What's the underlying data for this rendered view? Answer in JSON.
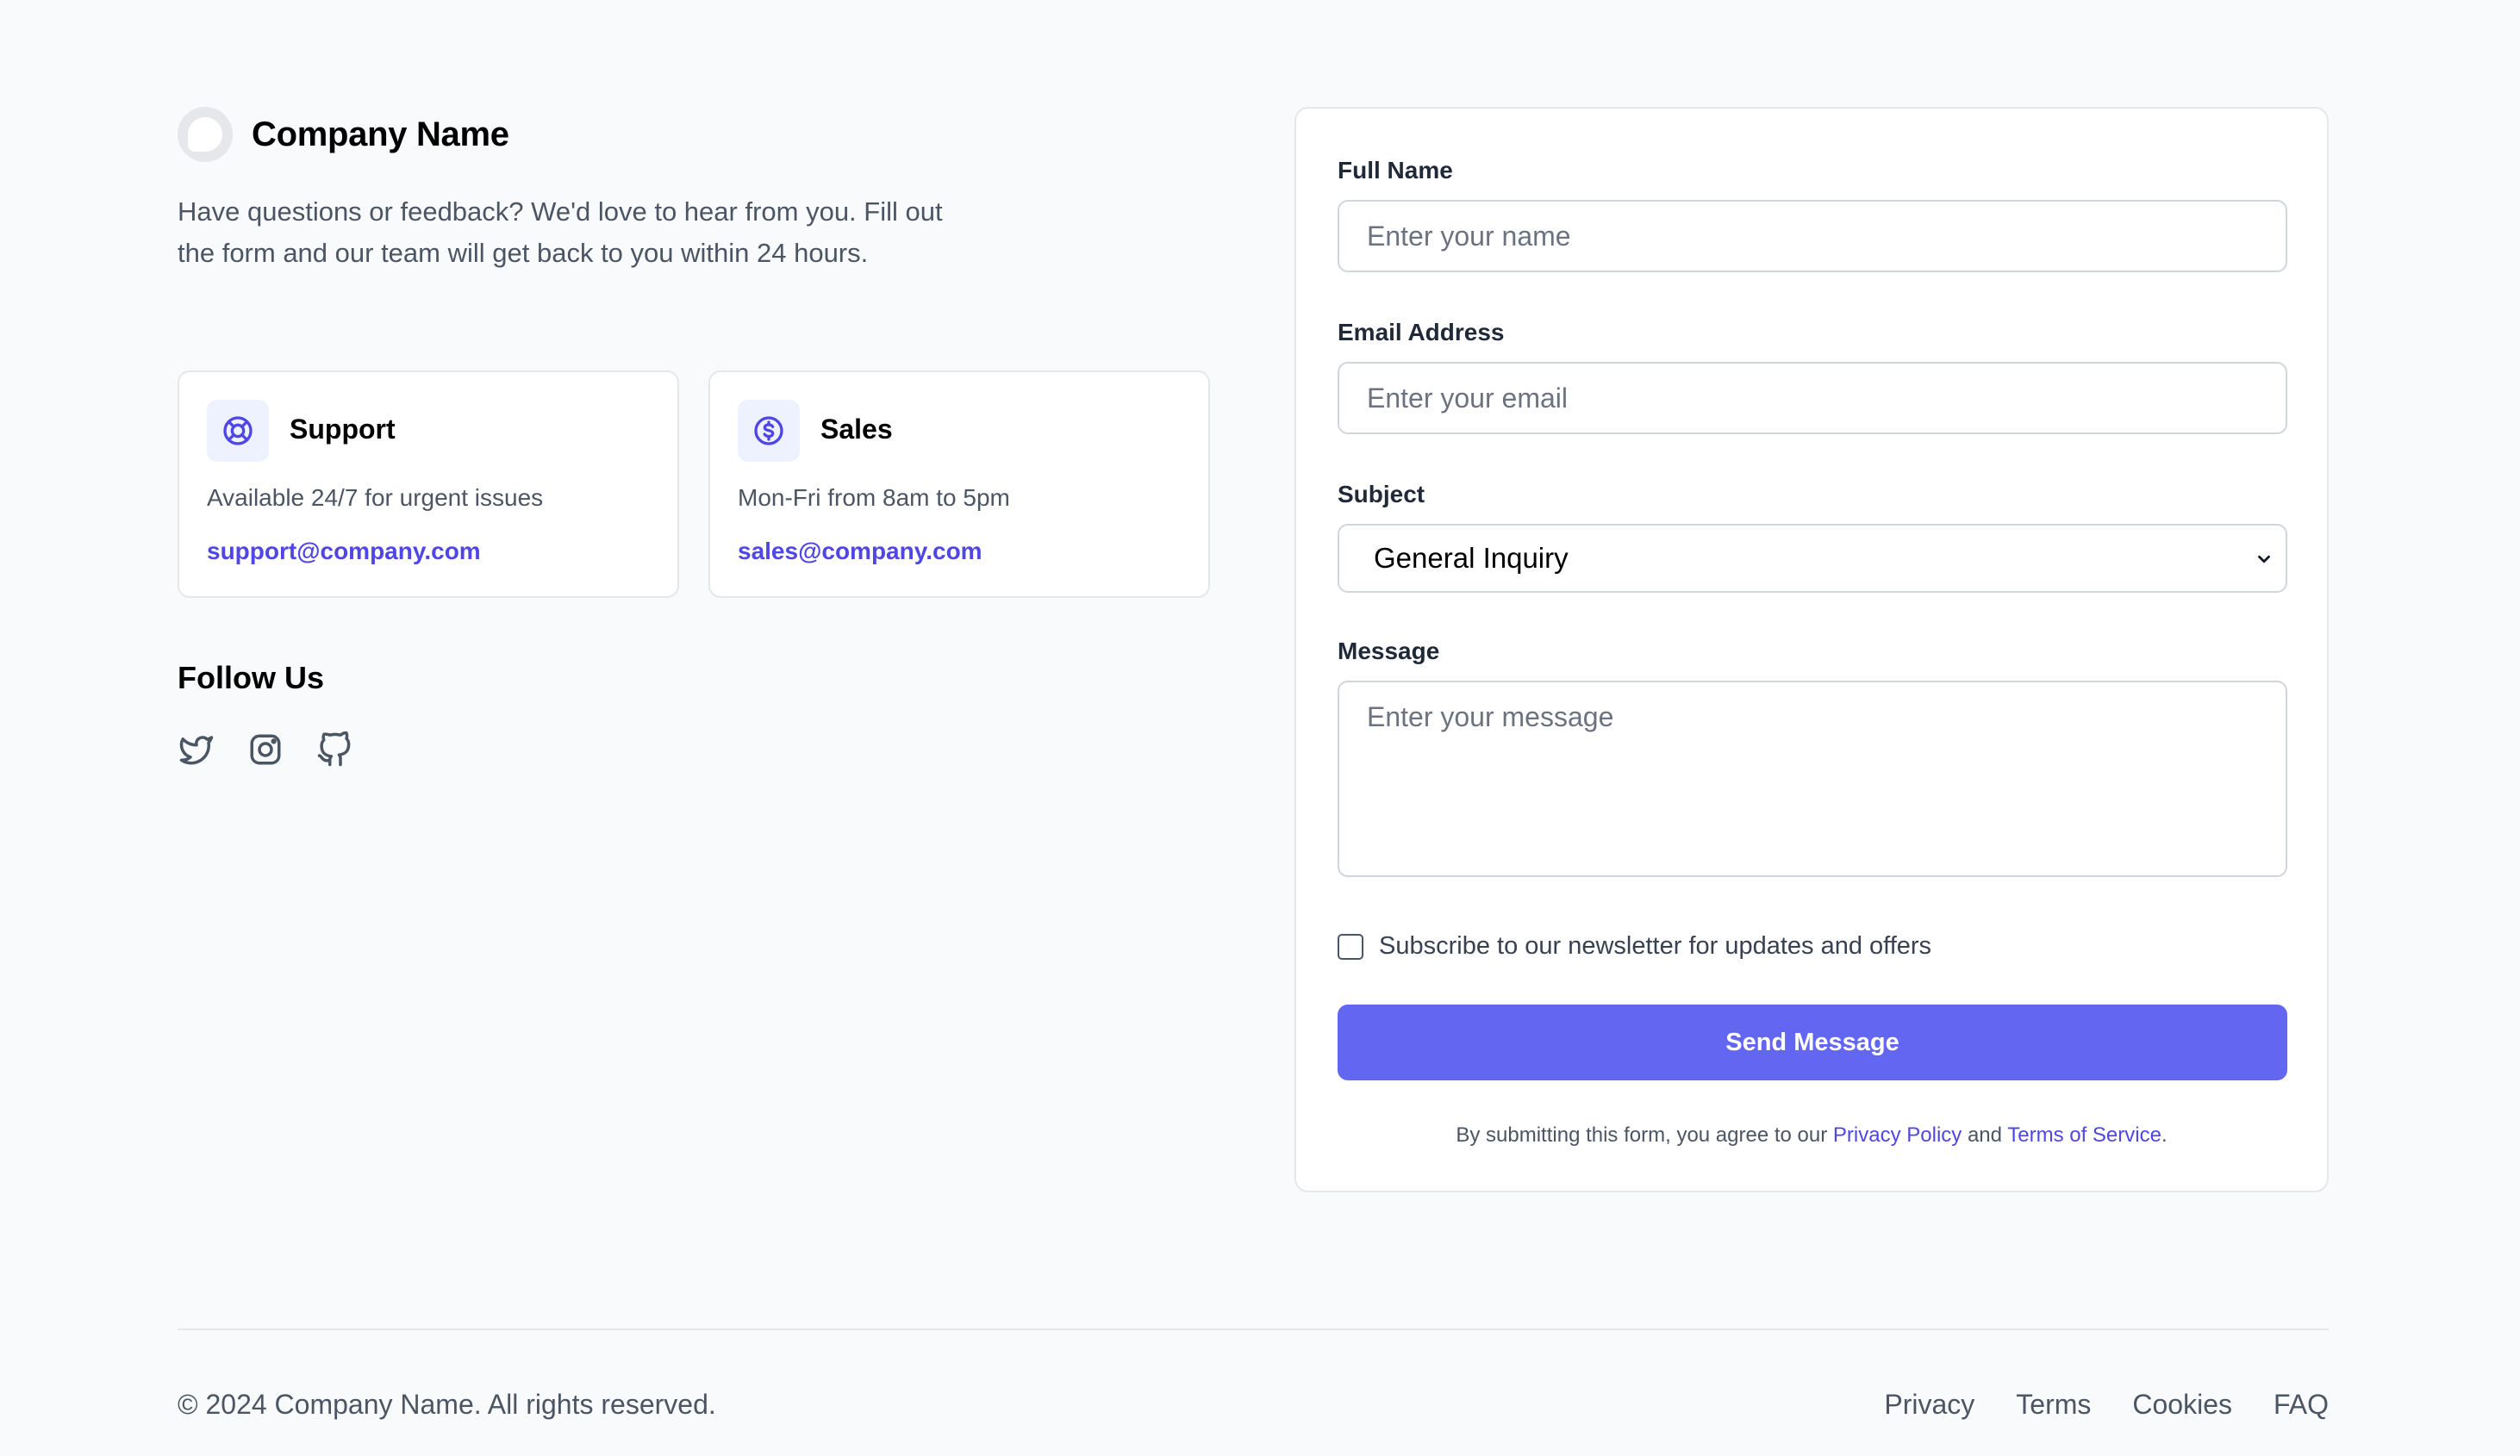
{
  "brand": {
    "name": "Company Name",
    "logo_icon": "company-logo"
  },
  "intro": "Have questions or feedback? We'd love to hear from you. Fill out the form and our team will get back to you within 24 hours.",
  "cards": {
    "support": {
      "icon": "lifebuoy-icon",
      "title": "Support",
      "description": "Available 24/7 for urgent issues",
      "email": "support@company.com"
    },
    "sales": {
      "icon": "dollar-circle-icon",
      "title": "Sales",
      "description": "Mon-Fri from 8am to 5pm",
      "email": "sales@company.com"
    }
  },
  "follow": {
    "title": "Follow Us",
    "icons": [
      "twitter-icon",
      "instagram-icon",
      "github-icon"
    ]
  },
  "form": {
    "name_label": "Full Name",
    "name_placeholder": "Enter your name",
    "email_label": "Email Address",
    "email_placeholder": "Enter your email",
    "subject_label": "Subject",
    "subject_value": "General Inquiry",
    "message_label": "Message",
    "message_placeholder": "Enter your message",
    "newsletter_label": "Subscribe to our newsletter for updates and offers",
    "newsletter_checked": false,
    "submit_label": "Send Message",
    "legal_prefix": "By submitting this form, you agree to our",
    "privacy_link": "Privacy Policy",
    "legal_and": "and",
    "terms_link": "Terms of Service",
    "legal_suffix": "."
  },
  "footer": {
    "copyright": "© 2024 Company Name. All rights reserved.",
    "links": [
      "Privacy",
      "Terms",
      "Cookies",
      "FAQ"
    ]
  },
  "colors": {
    "accent": "#6366f1",
    "link": "#4f46e5",
    "icon_bg": "#eef2ff",
    "background": "#f9fafb"
  }
}
